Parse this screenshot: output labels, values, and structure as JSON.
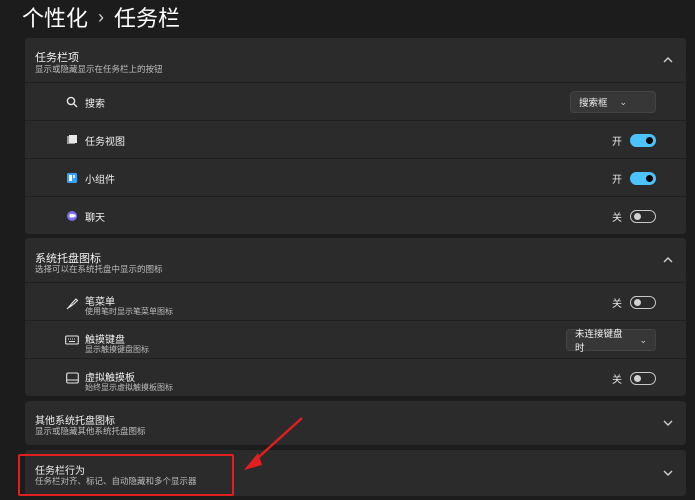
{
  "breadcrumb": {
    "parent": "个性化",
    "separator": "›",
    "current": "任务栏"
  },
  "taskbar_items": {
    "title": "任务栏项",
    "subtitle": "显示或隐藏显示在任务栏上的按钮",
    "rows": [
      {
        "label": "搜索",
        "icon": "search-icon",
        "control": "dropdown",
        "value": "搜索框"
      },
      {
        "label": "任务视图",
        "icon": "task-view-icon",
        "control": "toggle",
        "state": "开",
        "on": true
      },
      {
        "label": "小组件",
        "icon": "widgets-icon",
        "control": "toggle",
        "state": "开",
        "on": true
      },
      {
        "label": "聊天",
        "icon": "chat-icon",
        "control": "toggle",
        "state": "关",
        "on": false
      }
    ]
  },
  "tray_icons": {
    "title": "系统托盘图标",
    "subtitle": "选择可以在系统托盘中显示的图标",
    "rows": [
      {
        "label": "笔菜单",
        "desc": "使用笔时显示笔菜单图标",
        "icon": "pen-icon",
        "control": "toggle",
        "state": "关",
        "on": false
      },
      {
        "label": "触摸键盘",
        "desc": "显示触摸键盘图标",
        "icon": "keyboard-icon",
        "control": "dropdown",
        "value": "未连接键盘时"
      },
      {
        "label": "虚拟触摸板",
        "desc": "始终显示虚拟触摸板图标",
        "icon": "touchpad-icon",
        "control": "toggle",
        "state": "关",
        "on": false
      }
    ]
  },
  "other_tray": {
    "title": "其他系统托盘图标",
    "subtitle": "显示或隐藏其他系统托盘图标"
  },
  "behaviors": {
    "title": "任务栏行为",
    "subtitle": "任务栏对齐、标记、自动隐藏和多个显示器"
  },
  "colors": {
    "accent": "#4cc2ff",
    "highlight": "#e21e1e",
    "background": "#1c1c1c",
    "card": "#2b2b2b"
  }
}
